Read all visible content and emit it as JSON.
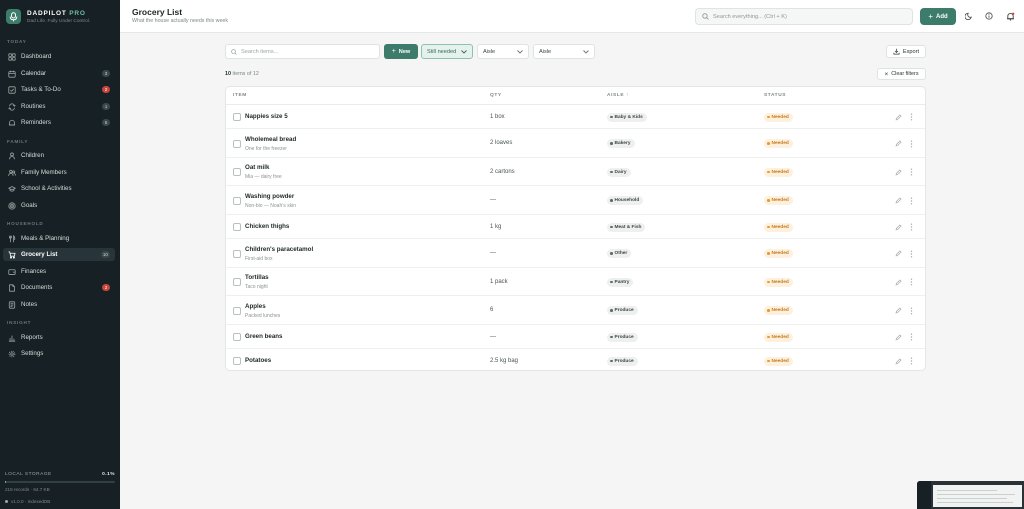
{
  "brand": {
    "name": "DADPILOT",
    "pro": "PRO",
    "tagline": "Dad Life. Fully Under Control."
  },
  "sidebar": {
    "sections": {
      "today": "TODAY",
      "family": "FAMILY",
      "household": "HOUSEHOLD",
      "insight": "INSIGHT"
    },
    "items": [
      {
        "label": "Dashboard",
        "icon": "grid-icon"
      },
      {
        "label": "Calendar",
        "icon": "calendar-icon",
        "badge": "3"
      },
      {
        "label": "Tasks & To-Do",
        "icon": "check-square-icon",
        "badge": "2",
        "badge_color": "#c8453a"
      },
      {
        "label": "Routines",
        "icon": "repeat-icon",
        "badge": "1"
      },
      {
        "label": "Reminders",
        "icon": "bell-icon",
        "badge": "5"
      },
      {
        "label": "Children",
        "icon": "child-icon"
      },
      {
        "label": "Family Members",
        "icon": "users-icon"
      },
      {
        "label": "School & Activities",
        "icon": "school-icon"
      },
      {
        "label": "Goals",
        "icon": "target-icon"
      },
      {
        "label": "Meals & Planning",
        "icon": "utensils-icon"
      },
      {
        "label": "Grocery List",
        "icon": "cart-icon",
        "badge": "10",
        "active": true
      },
      {
        "label": "Finances",
        "icon": "wallet-icon"
      },
      {
        "label": "Documents",
        "icon": "file-icon",
        "badge": "2",
        "badge_color": "#c8453a"
      },
      {
        "label": "Notes",
        "icon": "note-icon"
      },
      {
        "label": "Reports",
        "icon": "chart-icon"
      },
      {
        "label": "Settings",
        "icon": "gear-icon"
      }
    ],
    "storage": {
      "label": "LOCAL STORAGE",
      "percent_text": "0.1%",
      "fill_fraction": 0.001,
      "detail": "218 records · 64.7 KB"
    },
    "version": "v1.0.0 · IndexedDB"
  },
  "header": {
    "title": "Grocery List",
    "subtitle": "What the house actually needs this week",
    "search_placeholder": "Search everything... (Ctrl + K)",
    "add_label": "Add"
  },
  "toolbar": {
    "search_placeholder": "Search items...",
    "new_label": "New",
    "status_filter": "Still needed",
    "aisle_filter_1": "Aisle",
    "aisle_filter_2": "Aisle",
    "export_label": "Export",
    "count_number": "10",
    "count_suffix": "items of 12",
    "clear_filters": "Clear filters"
  },
  "table": {
    "headers": {
      "item": "ITEM",
      "qty": "QTY",
      "aisle": "AISLE ↑",
      "status": "STATUS"
    },
    "rows": [
      {
        "name": "Nappies size 5",
        "note": "",
        "qty": "1 box",
        "aisle": "Baby & Kids",
        "status": "Needed"
      },
      {
        "name": "Wholemeal bread",
        "note": "One for the freezer",
        "qty": "2 loaves",
        "aisle": "Bakery",
        "status": "Needed"
      },
      {
        "name": "Oat milk",
        "note": "Mia — dairy free",
        "qty": "2 cartons",
        "aisle": "Dairy",
        "status": "Needed"
      },
      {
        "name": "Washing powder",
        "note": "Non-bio — Noah's skin",
        "qty": "—",
        "aisle": "Household",
        "status": "Needed"
      },
      {
        "name": "Chicken thighs",
        "note": "",
        "qty": "1 kg",
        "aisle": "Meat & Fish",
        "status": "Needed"
      },
      {
        "name": "Children's paracetamol",
        "note": "First-aid box",
        "qty": "—",
        "aisle": "Other",
        "status": "Needed"
      },
      {
        "name": "Tortillas",
        "note": "Taco night",
        "qty": "1 pack",
        "aisle": "Pantry",
        "status": "Needed"
      },
      {
        "name": "Apples",
        "note": "Packed lunches",
        "qty": "6",
        "aisle": "Produce",
        "status": "Needed"
      },
      {
        "name": "Green beans",
        "note": "",
        "qty": "—",
        "aisle": "Produce",
        "status": "Needed"
      },
      {
        "name": "Potatoes",
        "note": "",
        "qty": "2.5 kg bag",
        "aisle": "Produce",
        "status": "Needed"
      }
    ]
  },
  "colors": {
    "accent": "#3d7c6a",
    "sidebar": "#172024",
    "needed": "#c47a1c",
    "alert": "#c8453a"
  }
}
